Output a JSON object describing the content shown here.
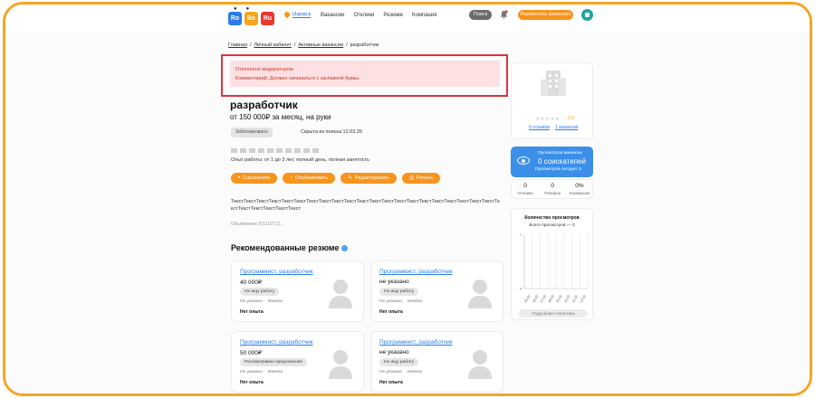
{
  "header": {
    "logo_letters": [
      "Ro",
      "Be",
      "Ru"
    ],
    "city": "Ижевск",
    "nav": [
      "Вакансии",
      "Отклики",
      "Резюме",
      "Компания"
    ],
    "search_label": "Поиск",
    "post_label": "Разместить вакансию"
  },
  "breadcrumb": [
    "Главная",
    "Личный кабинет",
    "Активные вакансии",
    "разработчик"
  ],
  "alert": {
    "title": "Отклонено модератором",
    "comment": "Комментарий: Должен начинаться с заглавной буквы."
  },
  "vacancy": {
    "title": "разработчик",
    "salary": "от 150 000₽ за месяц, на руки",
    "status_badge": "Заблокировано",
    "hidden_note": "Скрыта из поиска 12.03.26",
    "experience": "Опыт работы: от 1 до 3 лет, полный день, полная занятость",
    "actions": [
      {
        "icon": "pin-icon",
        "glyph": "•",
        "label": "Соискатели"
      },
      {
        "icon": "upload-icon",
        "glyph": "↑",
        "label": "Опубликовать"
      },
      {
        "icon": "edit-icon",
        "glyph": "✎",
        "label": "Редактировать"
      },
      {
        "icon": "print-icon",
        "glyph": "⎙",
        "label": "Печать"
      }
    ],
    "description": "ТекстТекстТекстТекстТекстТекстТекстТекстТекстТекстТекстТекстТекстТекстТекстТекстТекстТекстТекстТекстТекстТекстТекстТекстТекстТекстТекст",
    "ad_number": "Объявление ID1119712..."
  },
  "recommended": {
    "title": "Рекомендованные резюме",
    "cards": [
      {
        "title": "Программист, разработчик",
        "salary": "40 000₽",
        "badge": "Не ищу работу",
        "meta": [
          "Не указано",
          "Ижевск"
        ],
        "exp": "Нет опыта"
      },
      {
        "title": "Программист, разработчик",
        "salary": "не указано",
        "badge": "Не ищу работу",
        "meta": [
          "Не указано",
          "Ижевск"
        ],
        "exp": "Нет опыта"
      },
      {
        "title": "Программист, разработчик",
        "salary": "50 000₽",
        "badge": "Рассматриваю предложения",
        "meta": [
          "Не указано",
          "Ижевск"
        ],
        "exp": "Нет опыта"
      },
      {
        "title": "Программист, разработчик",
        "salary": "не указано",
        "badge": "Не ищу работу",
        "meta": [
          "Не указано",
          "Ижевск"
        ],
        "exp": "Нет опыта"
      }
    ]
  },
  "sidebar": {
    "rating": "0.0",
    "reviews_link": "0 отзывов",
    "vacancies_link": "1 вакансия",
    "views": {
      "label": "Просмотров вакансии",
      "count": "0 соискателей",
      "today": "Просмотров сегодня: 0"
    },
    "stats": [
      {
        "value": "0",
        "label": "Отклики"
      },
      {
        "value": "0",
        "label": "Телефон"
      },
      {
        "value": "0%",
        "label": "Конверсия"
      }
    ],
    "stats_button": "Подробная статистика"
  },
  "chart_data": {
    "type": "bar",
    "title": "Количество просмотров",
    "subtitle": "Всего просмотров — 0",
    "categories": [
      "05.03",
      "06.03",
      "07.03",
      "08.03",
      "09.03",
      "10.03",
      "11.03",
      "12.03"
    ],
    "values": [
      0,
      0,
      0,
      0,
      0,
      0,
      0,
      0
    ],
    "y_ticks": [
      "0",
      "1"
    ],
    "ylim": [
      0,
      1
    ],
    "grid": true
  }
}
